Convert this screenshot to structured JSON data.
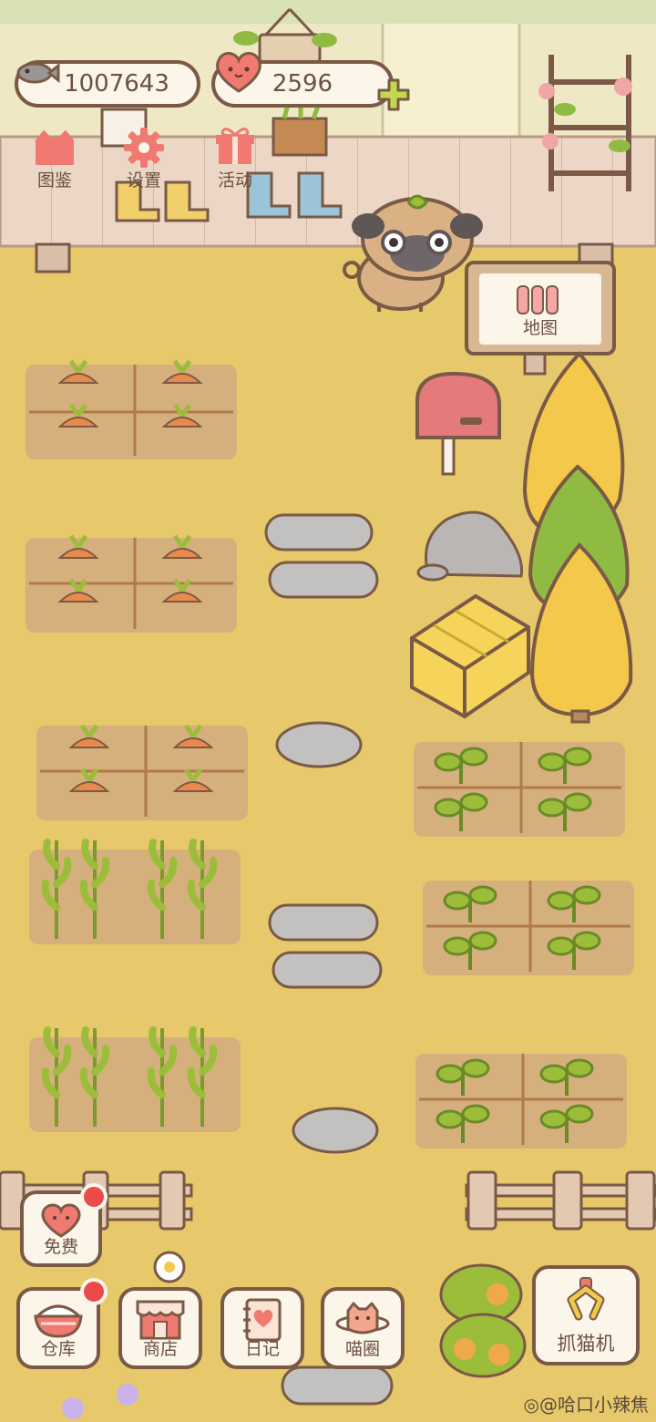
{
  "currency": {
    "fish_amount": "1007643",
    "heart_amount": "2596"
  },
  "top_menu": {
    "collection_label": "图鉴",
    "settings_label": "设置",
    "events_label": "活动"
  },
  "map_sign_label": "地图",
  "bottom_menu": {
    "free_label": "免费",
    "warehouse_label": "仓库",
    "shop_label": "商店",
    "diary_label": "日记",
    "meow_circle_label": "喵圈",
    "claw_machine_label": "抓猫机"
  },
  "watermark": "@哈口小辣焦",
  "colors": {
    "ground": "#e7c86a",
    "soil": "#d6b07c",
    "outline": "#7a5a46",
    "carrot": "#e98a4c",
    "sprout": "#9bbd3a",
    "tree_yellow": "#f4c84a",
    "tree_green": "#8fbb43",
    "notification": "#ea4a4a"
  }
}
